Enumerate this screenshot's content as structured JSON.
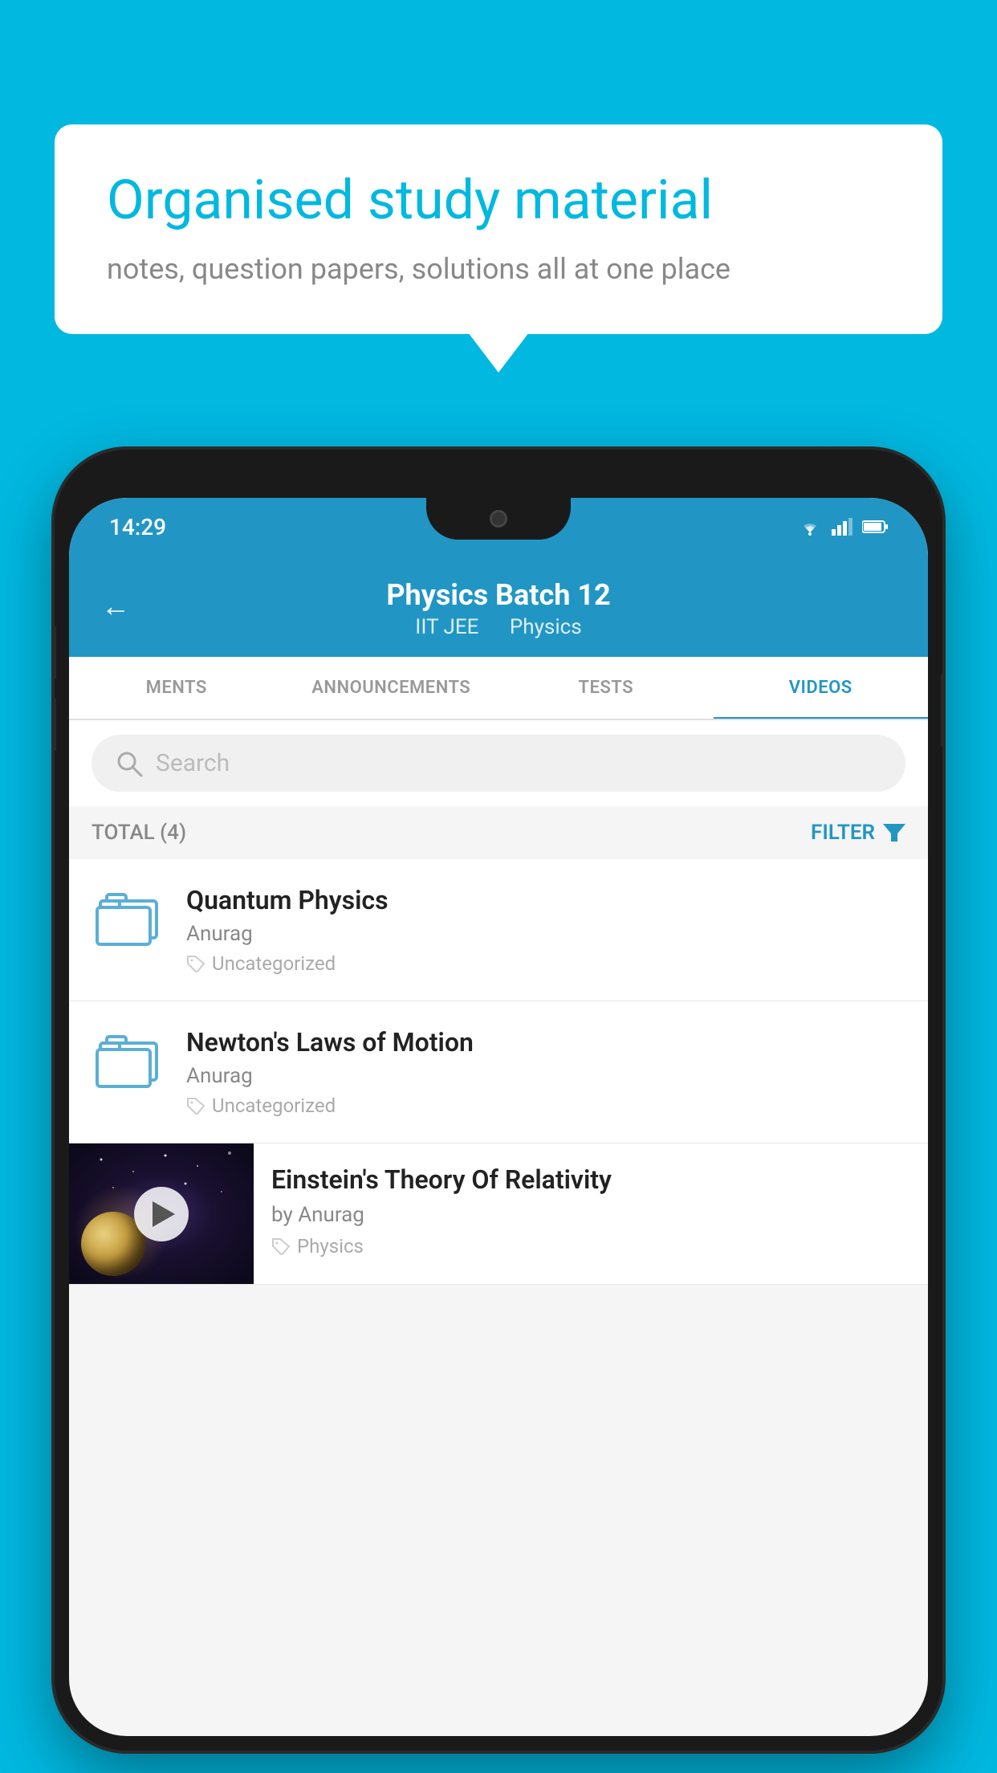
{
  "background_color": "#00b8e0",
  "bubble": {
    "title": "Organised study material",
    "subtitle": "notes, question papers, solutions all at one place"
  },
  "phone": {
    "status_bar": {
      "time": "14:29",
      "icons": [
        "wifi",
        "signal",
        "battery"
      ]
    },
    "header": {
      "back_label": "←",
      "title": "Physics Batch 12",
      "subtitle_part1": "IIT JEE",
      "subtitle_part2": "Physics"
    },
    "tabs": [
      {
        "label": "MENTS",
        "active": false
      },
      {
        "label": "ANNOUNCEMENTS",
        "active": false
      },
      {
        "label": "TESTS",
        "active": false
      },
      {
        "label": "VIDEOS",
        "active": true
      }
    ],
    "search": {
      "placeholder": "Search"
    },
    "filter_row": {
      "total_label": "TOTAL (4)",
      "filter_label": "FILTER"
    },
    "items": [
      {
        "title": "Quantum Physics",
        "author": "Anurag",
        "tag": "Uncategorized",
        "type": "folder"
      },
      {
        "title": "Newton's Laws of Motion",
        "author": "Anurag",
        "tag": "Uncategorized",
        "type": "folder"
      },
      {
        "title": "Einstein's Theory Of Relativity",
        "author": "by Anurag",
        "tag": "Physics",
        "type": "video"
      }
    ]
  }
}
